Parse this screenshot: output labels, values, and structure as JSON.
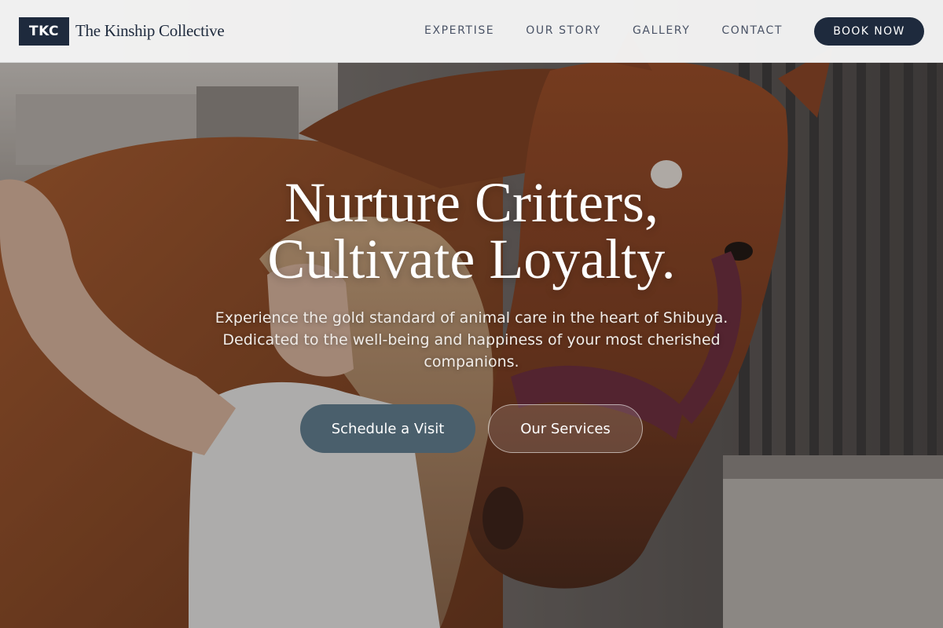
{
  "header": {
    "logo_mark": "TKC",
    "brand_name": "The Kinship Collective",
    "nav": [
      {
        "label": "EXPERTISE"
      },
      {
        "label": "OUR STORY"
      },
      {
        "label": "GALLERY"
      },
      {
        "label": "CONTACT"
      }
    ],
    "cta_label": "BOOK NOW"
  },
  "hero": {
    "headline_line1": "Nurture Critters,",
    "headline_line2": "Cultivate Loyalty.",
    "subtitle": "Experience the gold standard of animal care in the heart of Shibuya. Dedicated to the well-being and happiness of your most cherished companions.",
    "primary_button": "Schedule a Visit",
    "secondary_button": "Our Services",
    "image_subject": "woman grooming a chestnut horse in a stable"
  },
  "colors": {
    "brand_navy": "#1e2a3d",
    "primary_button": "#4a5f6c",
    "header_bg": "#f6f6f6"
  }
}
